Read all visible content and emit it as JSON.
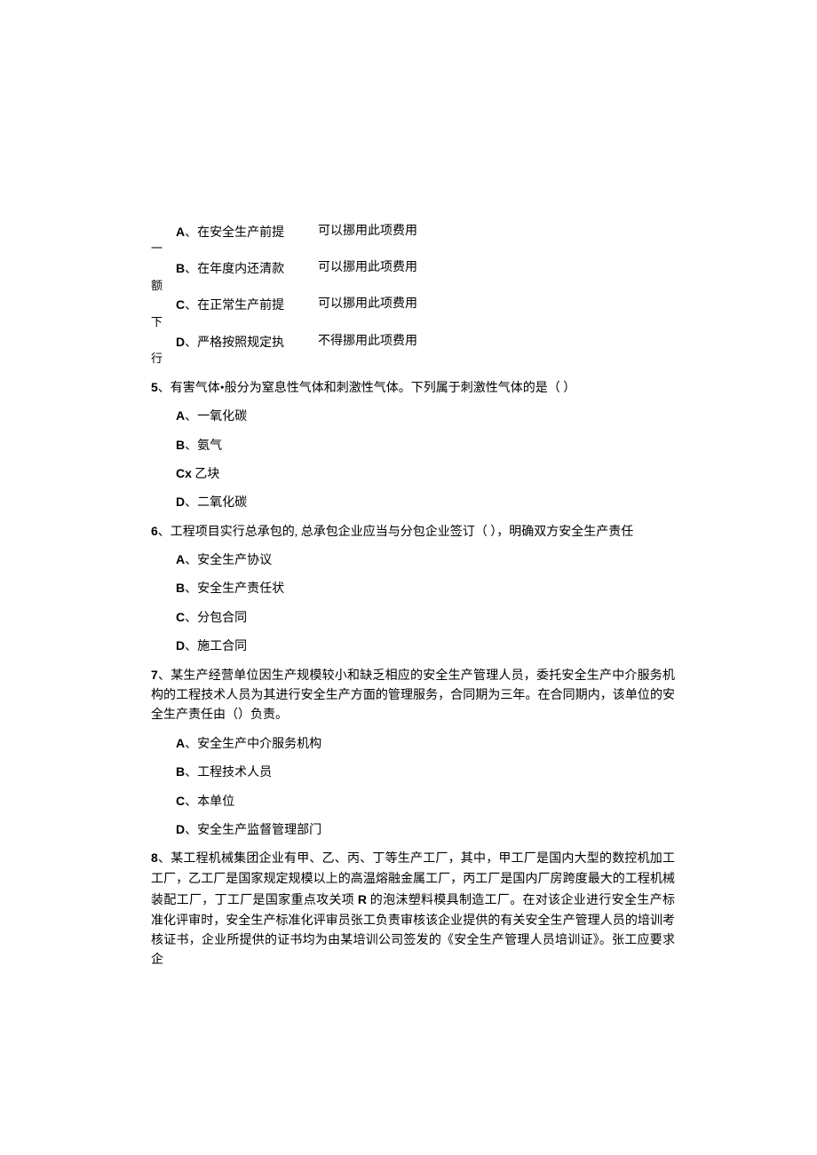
{
  "q4": {
    "optA_left": "A、在安全生产前提",
    "optA_right": "可以挪用此项费用",
    "optA_sub": "一",
    "optB_left": "B、在年度内还清款",
    "optB_right": "可以挪用此项费用",
    "optB_sub": "额",
    "optC_left": "C、在正常生产前提",
    "optC_right": "可以挪用此项费用",
    "optC_sub": "下",
    "optD_left": "D、严格按照规定执",
    "optD_right": "不得挪用此项费用",
    "optD_sub": "行"
  },
  "q5": {
    "num": "5",
    "stem": "、有害气体•般分为窒息性气体和刺激性气体。下列属于刺激性气体的是（        ）",
    "A_label": "A",
    "A_text": "、一氧化碳",
    "B_label": "B",
    "B_text": "、氨气",
    "C_label": "Cx",
    "C_text": " 乙块",
    "D_label": "D",
    "D_text": "、二氧化碳"
  },
  "q6": {
    "num": "6",
    "stem": "、工程项目实行总承包的, 总承包企业应当与分包企业签订（      ），明确双方安全生产责任",
    "A_label": "A",
    "A_text": "、安全生产协议",
    "B_label": "B",
    "B_text": "、安全生产责任状",
    "C_label": "C",
    "C_text": "、分包合同",
    "D_label": "D",
    "D_text": "、施工合同"
  },
  "q7": {
    "num": "7",
    "stem": "、某生产经营单位因生产规模较小和缺乏相应的安全生产管理人员，委托安全生产中介服务机构的工程技术人员为其进行安全生产方面的管理服务，合同期为三年。在合同期内，该单位的安全生产责任由（）负责。",
    "A_label": "A",
    "A_text": "、安全生产中介服务机构",
    "B_label": "B",
    "B_text": "、工程技术人员",
    "C_label": "C",
    "C_text": "、本单位",
    "D_label": "D",
    "D_text": "、安全生产监督管理部门"
  },
  "q8": {
    "num": "8",
    "stem1": "、某工程机械集团企业有甲、乙、丙、丁等生产工厂，其中，甲工厂是国内大型的数控机加工工厂，乙工厂是国家规定规模以上的高温熔融金属工厂，丙工厂是国内厂房跨度最大的工程机械装配工厂，丁工厂是国家重点攻关项 ",
    "stem_R": "R",
    "stem2": " 的泡沫塑料模具制造工厂。在对该企业进行安全生产标准化评审时，安全生产标准化评审员张工负责审核该企业提供的有关安全生产管理人员的培训考核证书，企业所提供的证书均为由某培训公司签发的《安全生产管理人员培训证》。张工应要求企"
  }
}
